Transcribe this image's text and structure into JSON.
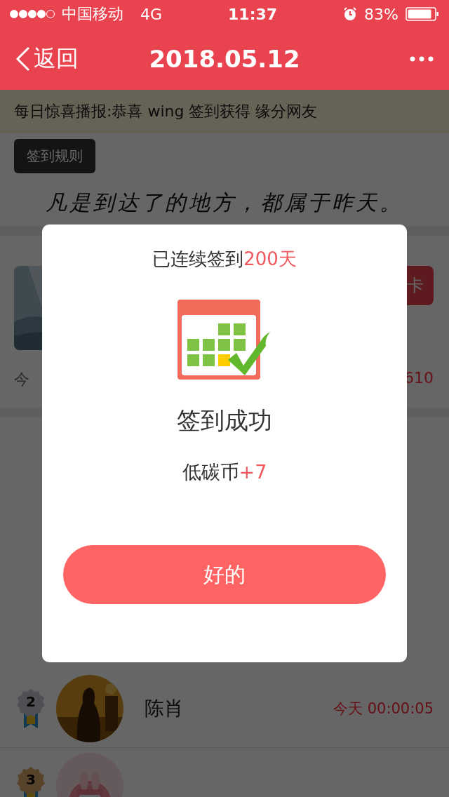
{
  "status_bar": {
    "carrier": "中国移动",
    "network": "4G",
    "time": "11:37",
    "battery": "83%"
  },
  "nav": {
    "back": "返回",
    "title": "2018.05.12"
  },
  "broadcast": {
    "label": "每日惊喜播报:",
    "message": "恭喜 wing 签到获得 缘分网友"
  },
  "rules_button": "签到规则",
  "quote": "凡是到达了的地方，都属于昨天。",
  "checkin_card": {
    "button": "卡",
    "stat_label": "今",
    "stat_value": "610"
  },
  "ranking": [
    {
      "rank": "2",
      "name": "陈肖",
      "time": "今天 00:00:05"
    },
    {
      "rank": "3"
    }
  ],
  "dialog": {
    "streak_prefix": "已连续签到",
    "streak_value": "200天",
    "title": "签到成功",
    "reward_label": "低碳币",
    "reward_value": "+7",
    "confirm": "好的"
  }
}
